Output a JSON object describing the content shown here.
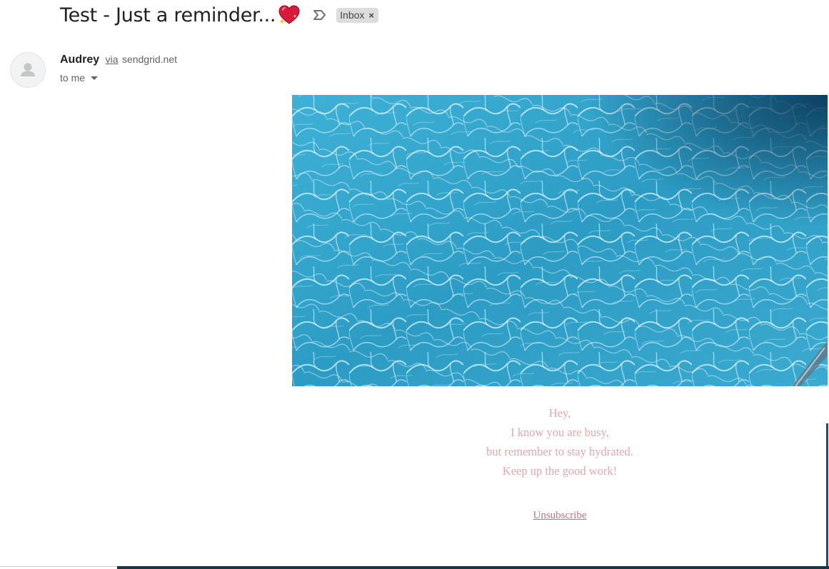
{
  "email": {
    "subject": "Test - Just a reminder...",
    "subject_emoji": "sparkling-heart-icon",
    "label_chip": "Inbox",
    "label_close": "×",
    "sender": {
      "name": "Audrey",
      "via_label": "via",
      "domain": "sendgrid.net"
    },
    "recipient_label": "to me"
  },
  "body": {
    "image_alt": "pool-water-image",
    "lines": [
      "Hey,",
      "I know you are busy,",
      "but remember to stay hydrated.",
      "Keep up the good work!"
    ],
    "unsubscribe_label": "Unsubscribe"
  },
  "colors": {
    "message_text": "#e0a7ac",
    "unsubscribe_link": "#b9777c",
    "chip_background": "#dddddd",
    "heart": "#d81b3c"
  }
}
